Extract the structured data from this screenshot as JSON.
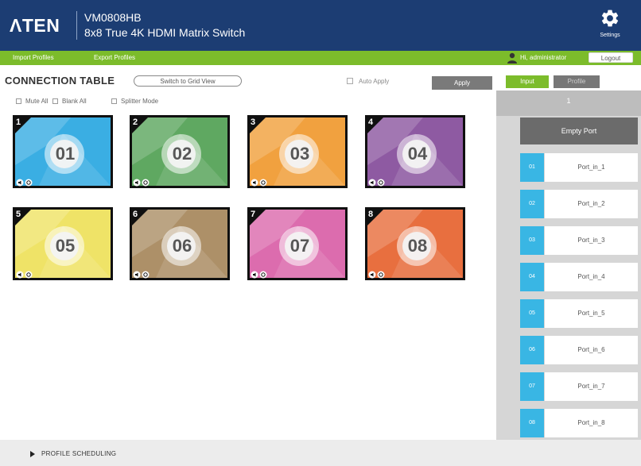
{
  "header": {
    "brand": "ΛTEN",
    "model": "VM0808HB",
    "product": "8x8 True 4K HDMI Matrix Switch",
    "settings_label": "Settings",
    "settings_icon": "gear-icon"
  },
  "menubar": {
    "import_profiles": "Import Profiles",
    "export_profiles": "Export Profiles",
    "user_text": "Hi, administrator",
    "logout_label": "Logout"
  },
  "toolbar": {
    "title": "CONNECTION TABLE",
    "switch_view_label": "Switch to Grid View",
    "auto_apply_label": "Auto Apply",
    "apply_label": "Apply",
    "mute_all": "Mute All",
    "blank_all": "Blank All",
    "splitter_mode": "Splitter Mode"
  },
  "outputs": [
    {
      "index": "1",
      "label": "01",
      "color": "#3aaee3"
    },
    {
      "index": "2",
      "label": "02",
      "color": "#5fa861"
    },
    {
      "index": "3",
      "label": "03",
      "color": "#f1a13f"
    },
    {
      "index": "4",
      "label": "04",
      "color": "#8e5aa2"
    },
    {
      "index": "5",
      "label": "05",
      "color": "#efe367"
    },
    {
      "index": "6",
      "label": "06",
      "color": "#ad9068"
    },
    {
      "index": "7",
      "label": "07",
      "color": "#dc6cae"
    },
    {
      "index": "8",
      "label": "08",
      "color": "#e86f3f"
    }
  ],
  "right_panel": {
    "tab_input": "Input",
    "tab_profile": "Profile",
    "selected_output": "1",
    "empty_port": "Empty Port",
    "ports": [
      {
        "badge": "01",
        "label": "Port_in_1"
      },
      {
        "badge": "02",
        "label": "Port_in_2"
      },
      {
        "badge": "03",
        "label": "Port_in_3"
      },
      {
        "badge": "04",
        "label": "Port_in_4"
      },
      {
        "badge": "05",
        "label": "Port_in_5"
      },
      {
        "badge": "06",
        "label": "Port_in_6"
      },
      {
        "badge": "07",
        "label": "Port_in_7"
      },
      {
        "badge": "08",
        "label": "Port_in_8"
      }
    ]
  },
  "footer": {
    "label": "PROFILE SCHEDULING"
  },
  "colors": {
    "header_bg": "#1c3d73",
    "accent_green": "#7cbc2b",
    "port_badge": "#39b6e4"
  }
}
